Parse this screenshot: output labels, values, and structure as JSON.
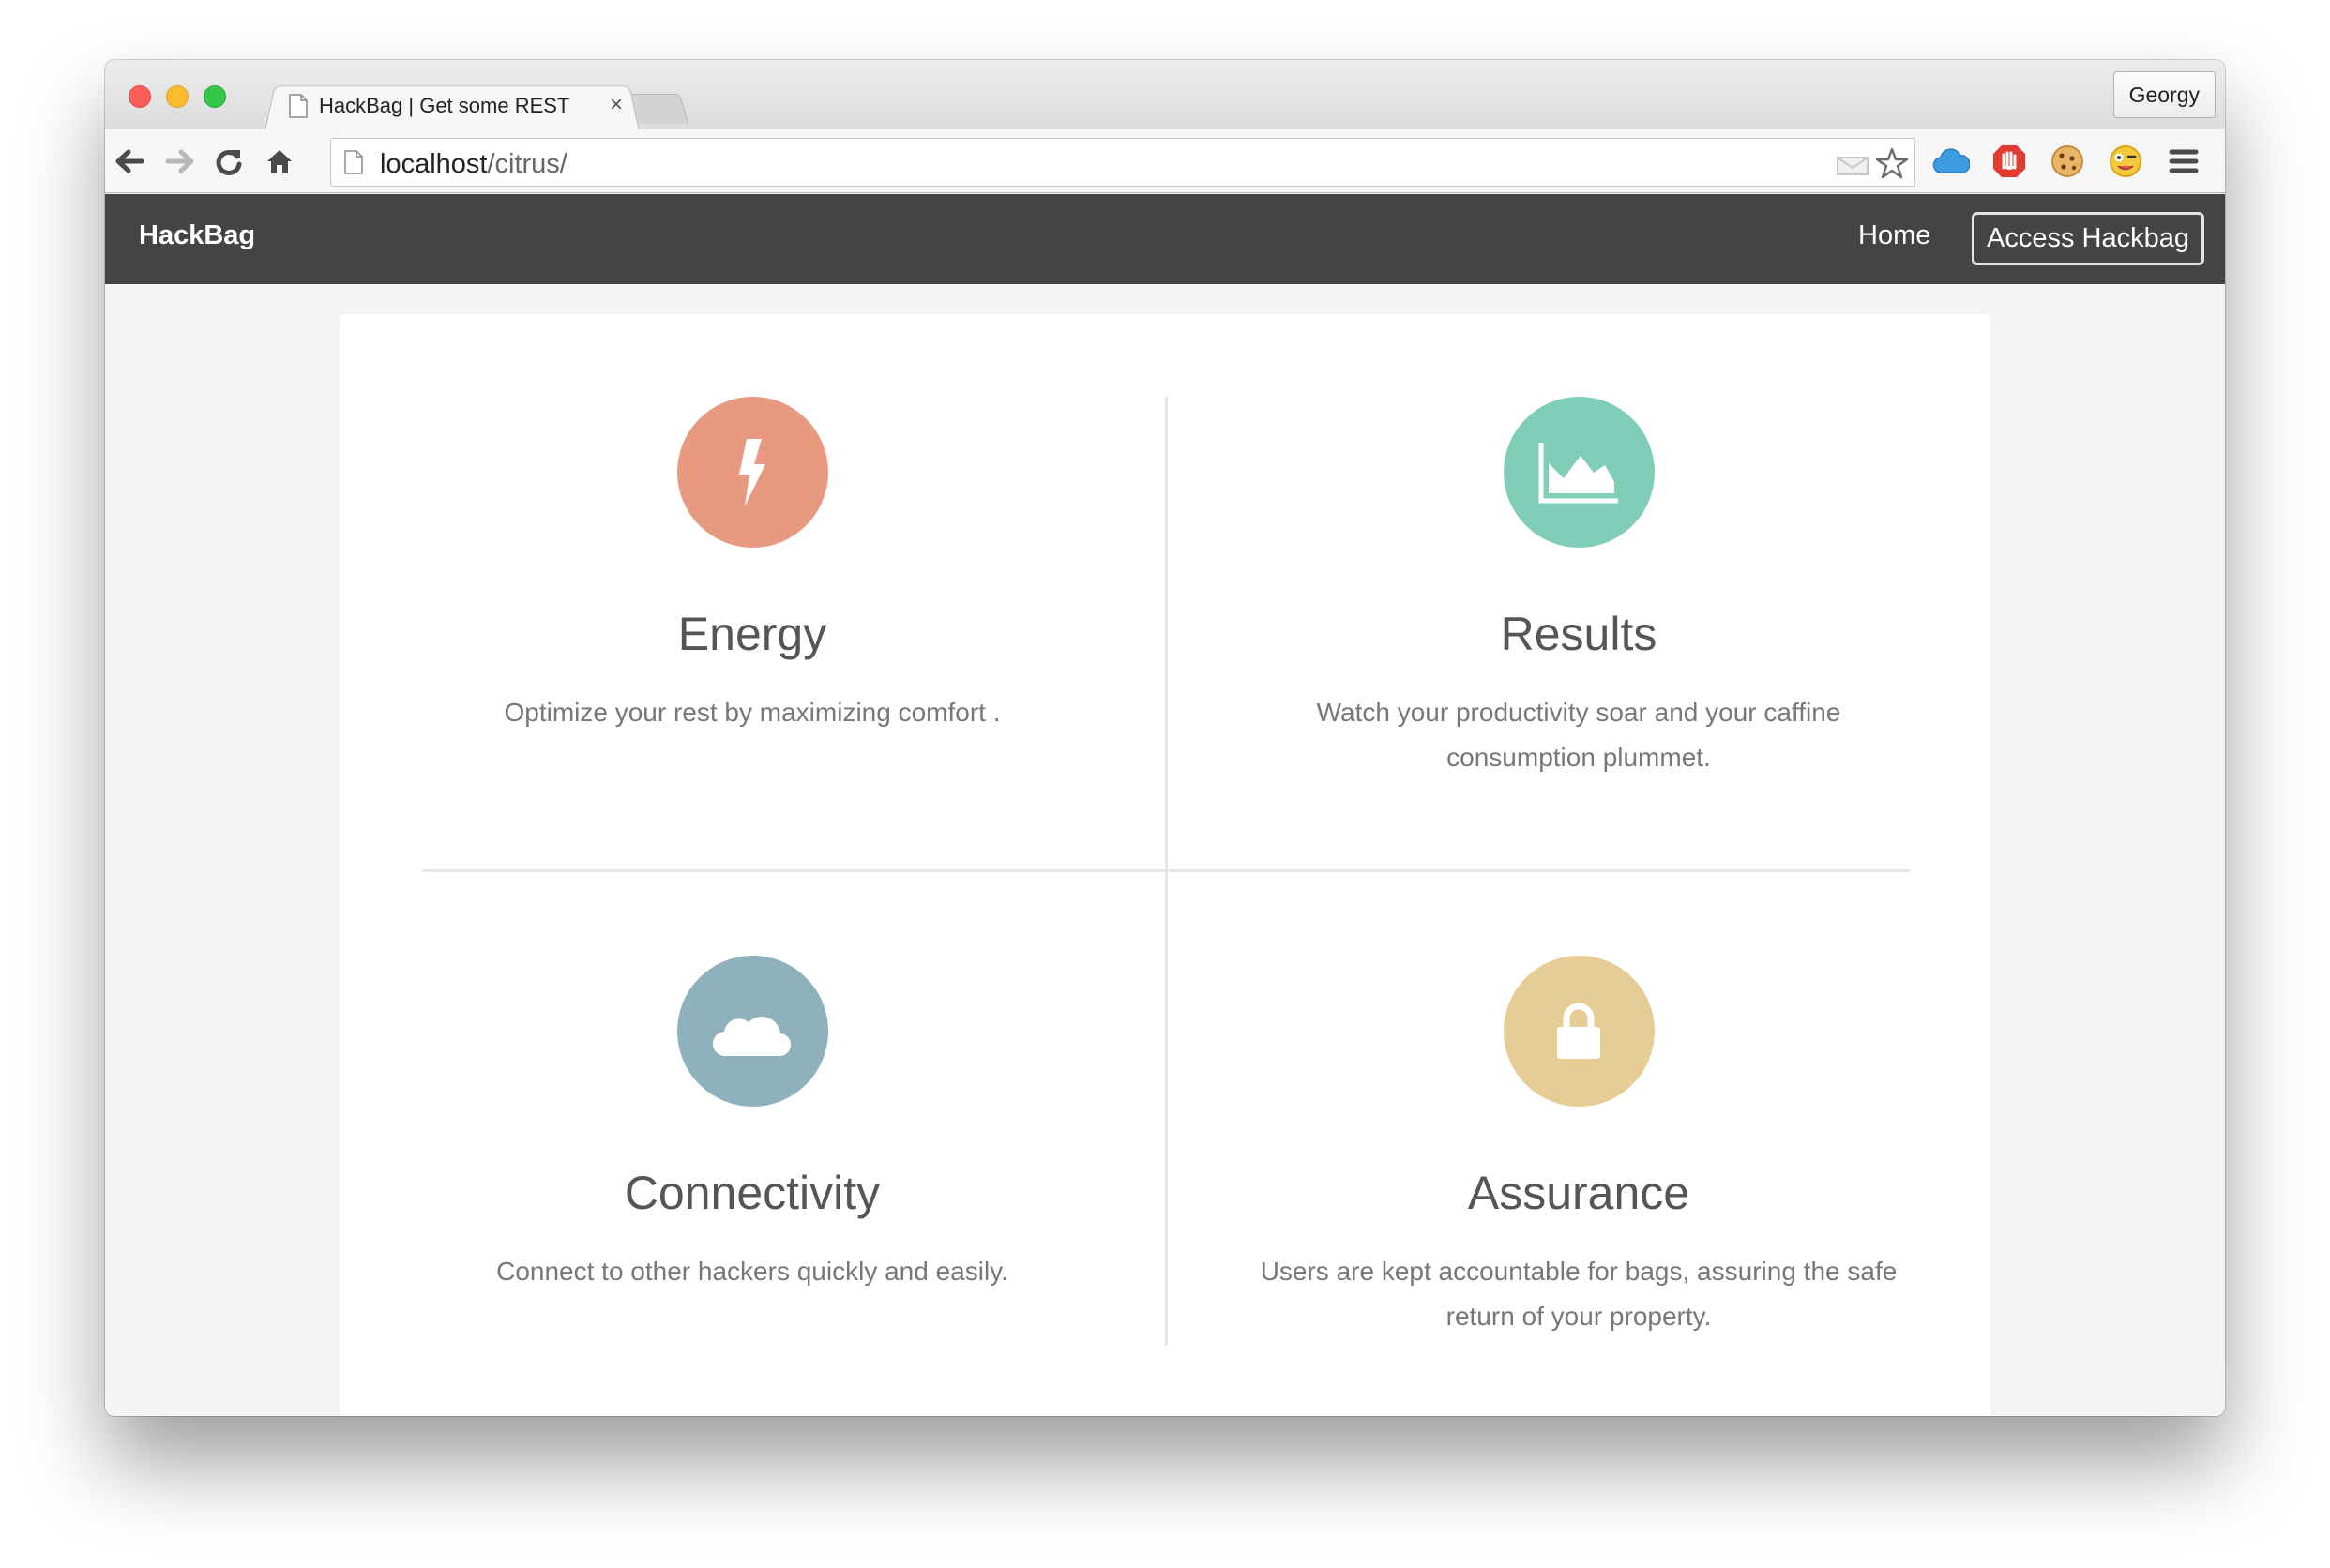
{
  "browser": {
    "tab_title": "HackBag | Get some REST",
    "tab_close": "×",
    "profile_name": "Georgy",
    "url_host": "localhost",
    "url_path": "/citrus/"
  },
  "navbar": {
    "brand": "HackBag",
    "home": "Home",
    "access": "Access Hackbag"
  },
  "features": [
    {
      "title": "Energy",
      "description": "Optimize your rest by maximizing comfort .",
      "icon": "lightning-bolt-icon",
      "color": "#e89a80"
    },
    {
      "title": "Results",
      "description": "Watch your productivity soar and your caffine consumption plummet.",
      "icon": "area-chart-icon",
      "color": "#80cdb8"
    },
    {
      "title": "Connectivity",
      "description": "Connect to other hackers quickly and easily.",
      "icon": "cloud-icon",
      "color": "#8fb1bb"
    },
    {
      "title": "Assurance",
      "description": "Users are kept accountable for bags, assuring the safe return of your property.",
      "icon": "lock-icon",
      "color": "#e6cc95"
    }
  ]
}
